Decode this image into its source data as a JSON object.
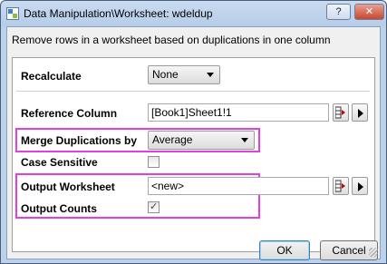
{
  "window": {
    "title": "Data Manipulation\\Worksheet: wdeldup",
    "help_label": "?",
    "close_label": "✕"
  },
  "description": "Remove rows in a worksheet based on duplications in one column",
  "form": {
    "recalculate": {
      "label": "Recalculate",
      "value": "None"
    },
    "reference_column": {
      "label": "Reference Column",
      "value": "[Book1]Sheet1!1"
    },
    "merge_duplications": {
      "label": "Merge Duplications by",
      "value": "Average"
    },
    "case_sensitive": {
      "label": "Case Sensitive",
      "checked": false
    },
    "output_worksheet": {
      "label": "Output Worksheet",
      "value": "<new>"
    },
    "output_counts": {
      "label": "Output Counts",
      "checked": true,
      "mark": "✓"
    }
  },
  "buttons": {
    "ok": "OK",
    "cancel": "Cancel"
  },
  "colors": {
    "highlight": "#e23ee6",
    "titlebar": "#bcd1ea"
  },
  "icons": [
    "app-icon",
    "help-icon",
    "close-icon",
    "column-picker-icon",
    "play-arrow-icon",
    "dropdown-arrow-icon",
    "checkmark-icon",
    "resize-grip-icon"
  ]
}
